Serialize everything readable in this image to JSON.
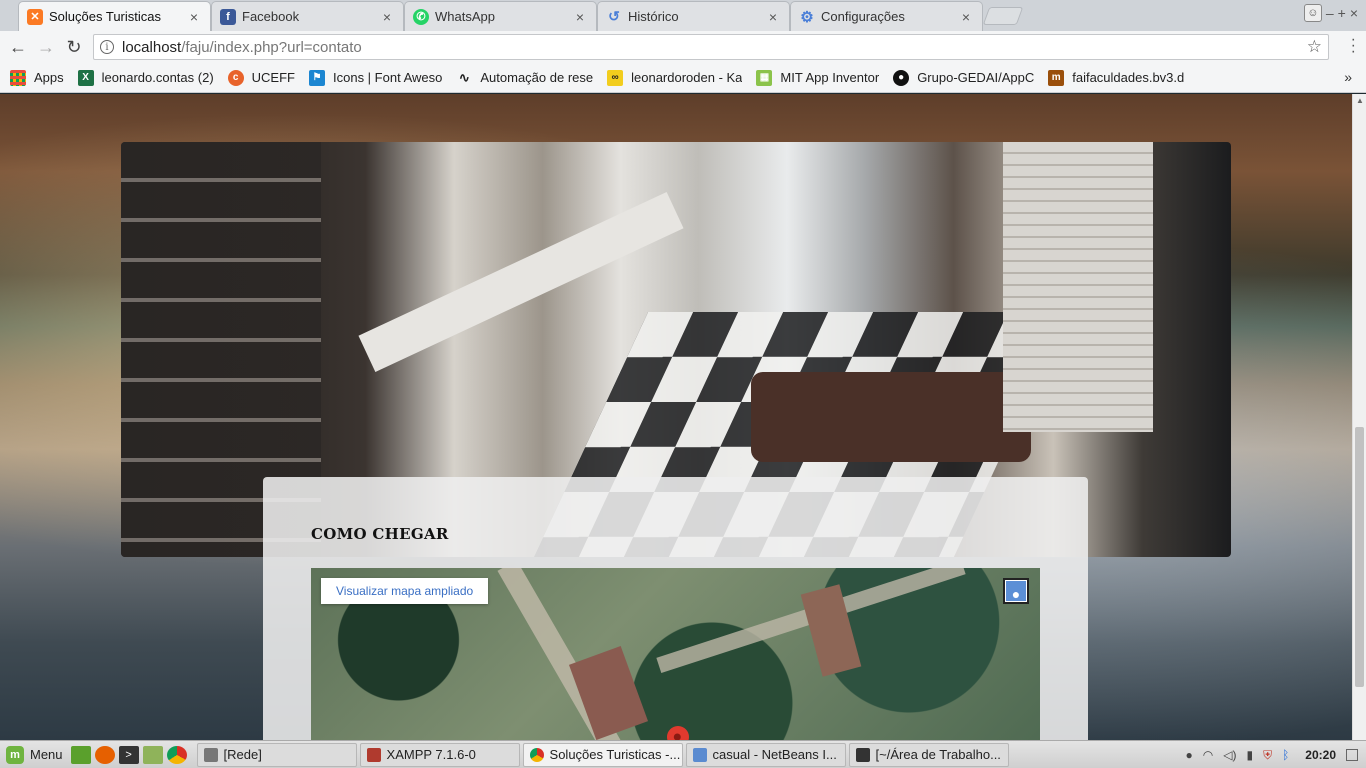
{
  "browser": {
    "tabs": [
      {
        "label": "Soluções Turisticas",
        "icon": "xampp-icon",
        "color": "#fb7a24",
        "active": true
      },
      {
        "label": "Facebook",
        "icon": "facebook-icon",
        "color": "#3b5998",
        "active": false
      },
      {
        "label": "WhatsApp",
        "icon": "whatsapp-icon",
        "color": "#25d366",
        "active": false
      },
      {
        "label": "Histórico",
        "icon": "history-icon",
        "color": "#4a7fd8",
        "active": false
      },
      {
        "label": "Configurações",
        "icon": "gear-icon",
        "color": "#4a7fd8",
        "active": false
      }
    ],
    "tab_close_glyph": "×",
    "window_controls": {
      "minimize": "–",
      "maximize": "+",
      "close": "×"
    },
    "address": {
      "host": "localhost",
      "path": "/faju/index.php?url=contato"
    },
    "bookmarks": [
      {
        "label": "Apps",
        "icon": "apps-grid-icon",
        "color": "#e84c3d"
      },
      {
        "label": "leonardo.contas (2)",
        "icon": "excel-icon",
        "color": "#1e7145"
      },
      {
        "label": "UCEFF",
        "icon": "uceff-icon",
        "color": "#e8632b"
      },
      {
        "label": "Icons | Font Aweso",
        "icon": "flag-icon",
        "color": "#1c86d1"
      },
      {
        "label": "Automação de rese",
        "icon": "wave-icon",
        "color": "#222222"
      },
      {
        "label": "leonardoroden - Ka",
        "icon": "infinity-icon",
        "color": "#f2cd1d"
      },
      {
        "label": "MIT App Inventor",
        "icon": "appinventor-icon",
        "color": "#8bc34a"
      },
      {
        "label": "Grupo-GEDAI/AppC",
        "icon": "github-icon",
        "color": "#111111"
      },
      {
        "label": "faifaculdades.bv3.d",
        "icon": "moodle-icon",
        "color": "#9a4f0b"
      }
    ],
    "bookmarks_overflow": "»"
  },
  "page": {
    "section_title": "COMO CHEGAR",
    "map": {
      "view_larger_label": "Visualizar mapa ampliado",
      "pegman_icon": "pegman-icon",
      "marker_icon": "map-pin-icon"
    }
  },
  "taskbar": {
    "menu_label": "Menu",
    "windows": [
      {
        "label": "[Rede]",
        "icon": "network-folder-icon",
        "color": "#777777",
        "active": false
      },
      {
        "label": "XAMPP 7.1.6-0",
        "icon": "xampp-icon",
        "color": "#b03a2e",
        "active": false
      },
      {
        "label": "Soluções Turisticas -...",
        "icon": "chrome-icon",
        "color": "#d93025",
        "active": true
      },
      {
        "label": "casual - NetBeans I...",
        "icon": "netbeans-icon",
        "color": "#5b8bd0",
        "active": false
      },
      {
        "label": "[~/Área de Trabalho...",
        "icon": "terminal-icon",
        "color": "#333333",
        "active": false
      }
    ],
    "clock": "20:20"
  }
}
